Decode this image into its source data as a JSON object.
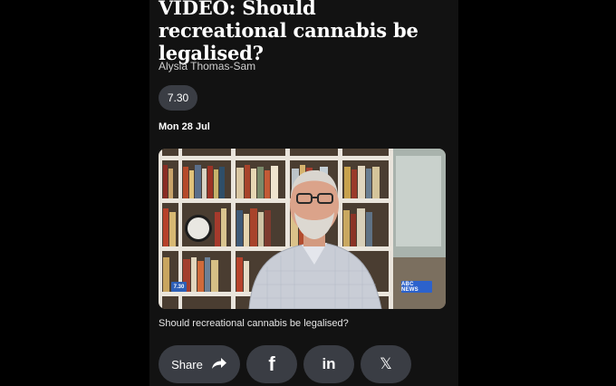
{
  "article": {
    "title": "VIDEO: Should recreational cannabis be legalised?",
    "author": "Alysia Thomas-Sam",
    "program_tag": "7.30",
    "date": "Mon 28 Jul"
  },
  "video": {
    "caption": "Should recreational cannabis be legalised?",
    "badge_left": "7.30",
    "badge_right": "ABC NEWS"
  },
  "share": {
    "share_label": "Share",
    "facebook_glyph": "f",
    "linkedin_glyph": "in",
    "x_glyph": "𝕏"
  },
  "icons": {
    "share": "share-arrow-icon",
    "facebook": "facebook-icon",
    "linkedin": "linkedin-icon",
    "x": "x-icon"
  },
  "colors": {
    "background": "#121212",
    "button": "#3a3d44",
    "abc_blue": "#2c62cc"
  }
}
